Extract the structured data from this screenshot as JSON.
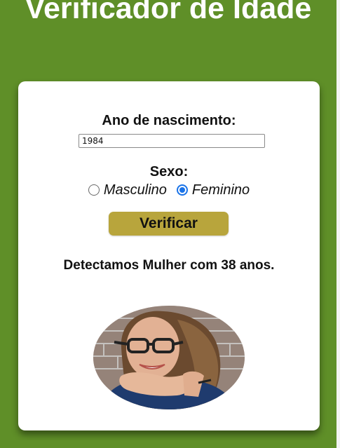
{
  "page": {
    "title": "Verificador de Idade"
  },
  "form": {
    "year_label": "Ano de nascimento:",
    "year_value": "1984",
    "sex_label": "Sexo:",
    "options": [
      {
        "label": "Masculino",
        "checked": false
      },
      {
        "label": "Feminino",
        "checked": true
      }
    ],
    "verify_button": "Verificar"
  },
  "result": {
    "text": "Detectamos Mulher com 38 anos.",
    "image_icon": "woman-photo"
  },
  "colors": {
    "background": "#5f8f28",
    "button": "#b8a53c",
    "radio_checked": "#1a73e8"
  }
}
